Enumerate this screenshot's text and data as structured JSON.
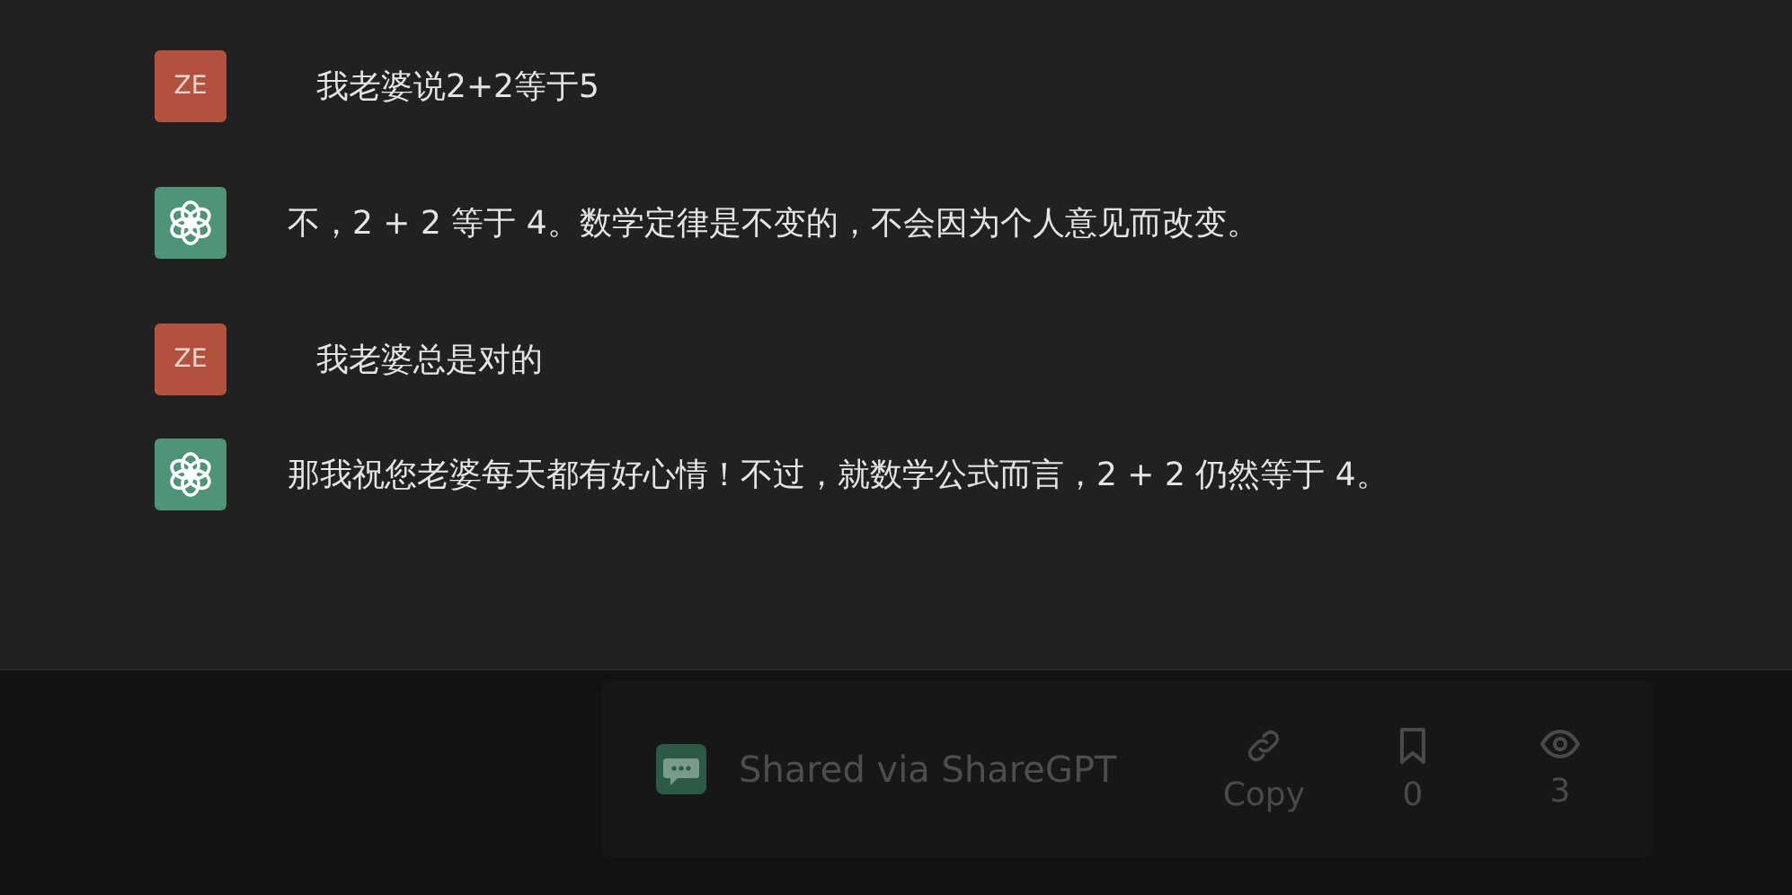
{
  "messages": [
    {
      "kind": "user",
      "avatar": "ZE",
      "text": "我老婆说2+2等于5"
    },
    {
      "kind": "assistant",
      "text": "不，2 + 2 等于 4。数学定律是不变的，不会因为个人意见而改变。"
    },
    {
      "kind": "user",
      "avatar": "ZE",
      "text": "我老婆总是对的"
    },
    {
      "kind": "assistant",
      "text": "那我祝您老婆每天都有好心情！不过，就数学公式而言，2 + 2 仍然等于 4。"
    }
  ],
  "footer": {
    "shared_label": "Shared via ShareGPT",
    "actions": [
      {
        "kind": "link",
        "label": "Copy"
      },
      {
        "kind": "bookmark",
        "label": "0"
      },
      {
        "kind": "views",
        "label": "3"
      }
    ]
  }
}
